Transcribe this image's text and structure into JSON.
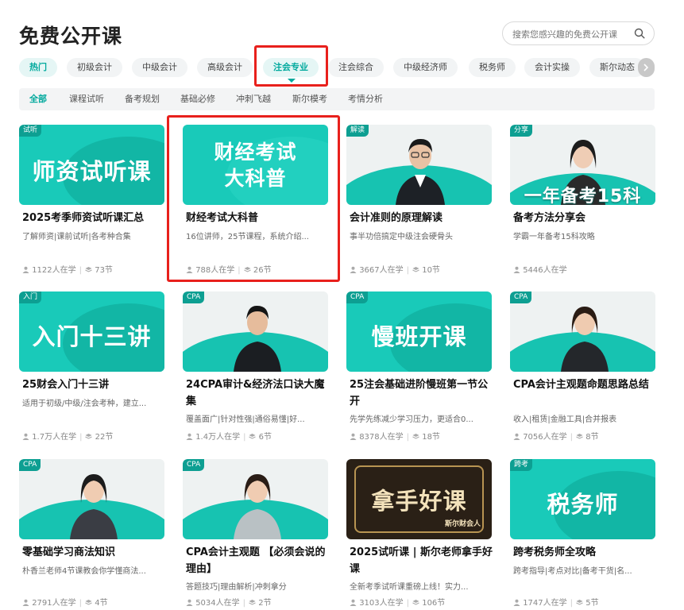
{
  "title": "免费公开课",
  "search": {
    "placeholder": "搜索您感兴趣的免费公开课"
  },
  "categories": [
    {
      "label": "热门"
    },
    {
      "label": "初级会计"
    },
    {
      "label": "中级会计"
    },
    {
      "label": "高级会计"
    },
    {
      "label": "注会专业"
    },
    {
      "label": "注会综合"
    },
    {
      "label": "中级经济师"
    },
    {
      "label": "税务师"
    },
    {
      "label": "会计实操"
    },
    {
      "label": "斯尔动态"
    }
  ],
  "subtabs": [
    {
      "label": "全部"
    },
    {
      "label": "课程试听"
    },
    {
      "label": "备考规划"
    },
    {
      "label": "基础必修"
    },
    {
      "label": "冲刺飞越"
    },
    {
      "label": "斯尔模考"
    },
    {
      "label": "考情分析"
    }
  ],
  "courses": [
    {
      "badge": "试听",
      "thumb_text": "师资试听课",
      "title": "2025考季师资试听课汇总",
      "desc": "了解师资|课前试听|各考种合集",
      "learners": "1122人在学",
      "lessons": "73节"
    },
    {
      "badge": "",
      "thumb_text": "财经考试 大科普",
      "title": "财经考试大科普",
      "desc": "16位讲师，25节课程，系统介绍...",
      "learners": "788人在学",
      "lessons": "26节"
    },
    {
      "badge": "解读",
      "thumb_text": "",
      "title": "会计准则的原理解读",
      "desc": "事半功倍搞定中级注会硬骨头",
      "learners": "3667人在学",
      "lessons": "10节"
    },
    {
      "badge": "分享",
      "thumb_text": "一年备考15科",
      "title": "备考方法分享会",
      "desc": "学霸一年备考15科攻略",
      "learners": "5446人在学",
      "lessons": ""
    },
    {
      "badge": "入门",
      "thumb_text": "入门十三讲",
      "title": "25财会入门十三讲",
      "desc": "适用于初级/中级/注会考种，建立...",
      "learners": "1.7万人在学",
      "lessons": "22节"
    },
    {
      "badge": "CPA",
      "thumb_text": "",
      "title": "24CPA审计&经济法口诀大魔集",
      "desc": "覆盖面广|针对性强|通俗易懂|好...",
      "learners": "1.4万人在学",
      "lessons": "6节"
    },
    {
      "badge": "CPA",
      "thumb_text": "慢班开课",
      "title": "25注会基础进阶慢班第一节公开",
      "desc": "先学先练减少学习压力，更适合0...",
      "learners": "8378人在学",
      "lessons": "18节"
    },
    {
      "badge": "CPA",
      "thumb_text": "",
      "title": "CPA会计主观题命题思路总结",
      "desc": "收入|租赁|金融工具|合并报表",
      "learners": "7056人在学",
      "lessons": "8节"
    },
    {
      "badge": "CPA",
      "thumb_text": "",
      "title": "零基础学习商法知识",
      "desc": "朴香兰老师4节课教会你学懂商法...",
      "learners": "2791人在学",
      "lessons": "4节"
    },
    {
      "badge": "CPA",
      "thumb_text": "",
      "title": "CPA会计主观题 【必须会说的理由】",
      "desc": "答题技巧|理由解析|冲刺拿分",
      "learners": "5034人在学",
      "lessons": "2节"
    },
    {
      "badge": "",
      "thumb_text": "拿手好课",
      "thumb_sub": "斯尔财会人",
      "title": "2025试听课 | 斯尔老师拿手好课",
      "desc": "全新考季试听课重磅上线！实力...",
      "learners": "3103人在学",
      "lessons": "106节"
    },
    {
      "badge": "跨考",
      "thumb_text": "税务师",
      "title": "跨考税务师全攻略",
      "desc": "跨考指导|考点对比|备考干货|名...",
      "learners": "1747人在学",
      "lessons": "5节"
    }
  ],
  "colors": {
    "accent": "#00a99d",
    "highlight_box": "#e8201c",
    "thumb_bg": "#19cab9"
  }
}
